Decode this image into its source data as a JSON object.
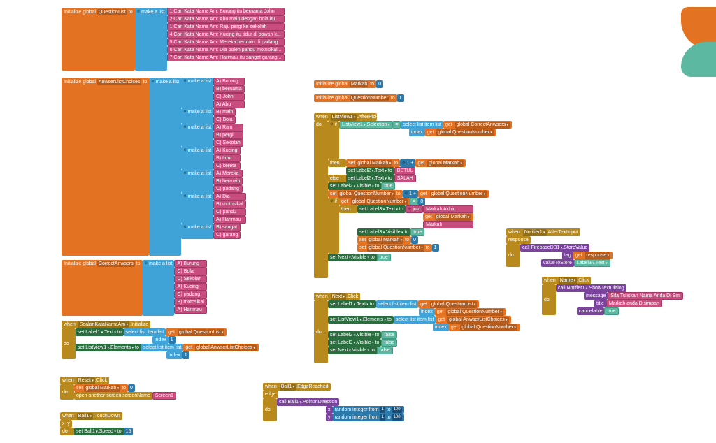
{
  "text": {
    "init_global": "Initialize global",
    "to": "to",
    "make_list": "make a list",
    "when": "when",
    "do": "do",
    "if": "if",
    "then": "then",
    "else": "else",
    "set": "set",
    "get": "get",
    "call": "call",
    "select_item": "select list item list",
    "index": "index",
    "open_screen": "open another screen  screenName",
    "random_int": "random integer from",
    "join": "join",
    "message": "message",
    "title": "title",
    "cancelable": "cancelable",
    "tag": "tag",
    "valueToStore": "valueToStore",
    "edge": "edge",
    "x": "x",
    "y": "y",
    "response": "response"
  },
  "vars": {
    "QuestionList": "QuestionList",
    "AnwserListChoices": "AnwserListChoices",
    "CorrectAnwsers": "CorrectAnwsers",
    "Markah": "Markah",
    "QuestionNumber": "QuestionNumber"
  },
  "questions": [
    "1.Cari Kata Nama Am: Burung itu bernama John",
    "2.Cari Kata Nama Am: Abu main dengan bola itu",
    "1.Cari Kata Nama Am: Raju pergi ke sekolah",
    "4.Cari Kata Nama Am: Kucing itu tidur di bawah k...",
    "5.Cari Kata Nama Am: Mereka bermain di padang",
    "6.Cari Kata Nama Am: Dia boleh pandu motosikal...",
    "7.Cari Kata Nama Am: Harimau itu sangat garang..."
  ],
  "choices": [
    [
      "A) Burung",
      "B) bernama",
      "C) John",
      "A) Abu"
    ],
    [
      "B) main",
      "C) Bola"
    ],
    [
      "A) Raju",
      "B) pergi",
      "C) Sekolah"
    ],
    [
      "A) Kucing",
      "B) tidur",
      "C) kereta"
    ],
    [
      "A) Mereka",
      "B) bermain",
      "C) padang"
    ],
    [
      "A) Dia",
      "B) motosikal",
      "C) pandu",
      "A) Harimau"
    ],
    [
      "B) sangat",
      "C) garang"
    ]
  ],
  "correct": [
    "A) Burung",
    "C) Bola",
    "C) Sekolah",
    "A) Kucing",
    "C) padang",
    "B) motosikal",
    "A) Harimau"
  ],
  "components": {
    "ListView1": "ListView1",
    "Label1": "Label1",
    "Label2": "Label2",
    "Label3": "Label3",
    "Next": "Next",
    "Reset": "Reset",
    "Ball1": "Ball1",
    "Notifier1": "Notifier1",
    "Name": "Name",
    "FirebaseDB1": "FirebaseDB1",
    "SoalanKataNamaAm": "SoalanKataNamaAm",
    "Screen1": "Screen1"
  },
  "props": {
    "AfterPicking": ".AfterPicking",
    "Selection": ".Selection",
    "Text": ".Text",
    "Visible": ".Visible",
    "Elements": ".Elements",
    "Click": ".Click",
    "Initialize": ".Initialize",
    "TouchDown": ".TouchDown",
    "Speed": ".Speed",
    "EdgeReached": ".EdgeReached",
    "PointInDirection": ".PointInDirection",
    "AfterTextInput": ".AfterTextInput",
    "StoreValue": ".StoreValue",
    "ShowTextDialog": ".ShowTextDialog"
  },
  "strings": {
    "betul": "BETUL",
    "salah": "SALAH",
    "markah_akhir": "Markah Akhir:",
    "markah": "Markah",
    "true": "true",
    "false": "false",
    "sila": "Sila Tuliskan Nama Anda Di Sini",
    "disimpan": "Markah anda Disimpan"
  },
  "nums": {
    "n0": "0",
    "n1": "1",
    "n8": "8",
    "n15": "15",
    "n100": "100",
    "eq": "=",
    "plus": "+"
  }
}
